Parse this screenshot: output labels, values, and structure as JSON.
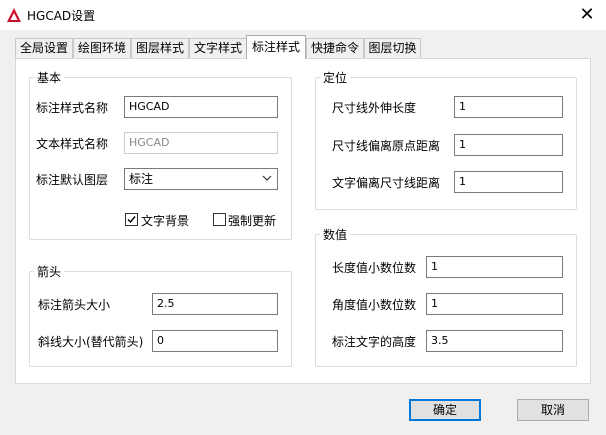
{
  "window": {
    "title": "HGCAD设置",
    "close_glyph": "✕"
  },
  "tabs": [
    {
      "label": "全局设置"
    },
    {
      "label": "绘图环境"
    },
    {
      "label": "图层样式"
    },
    {
      "label": "文字样式"
    },
    {
      "label": "标注样式",
      "active": true
    },
    {
      "label": "快捷命令"
    },
    {
      "label": "图层切换"
    }
  ],
  "basic": {
    "legend": "基本",
    "dim_style_name_label": "标注样式名称",
    "dim_style_name_value": "HGCAD",
    "text_style_name_label": "文本样式名称",
    "text_style_name_value": "HGCAD",
    "default_layer_label": "标注默认图层",
    "default_layer_value": "标注",
    "text_bg_label": "文字背景",
    "text_bg_checked": true,
    "force_update_label": "强制更新",
    "force_update_checked": false
  },
  "arrow": {
    "legend": "箭头",
    "arrow_size_label": "标注箭头大小",
    "arrow_size_value": "2.5",
    "oblique_size_label": "斜线大小(替代箭头)",
    "oblique_size_value": "0"
  },
  "position": {
    "legend": "定位",
    "ext_len_label": "尺寸线外伸长度",
    "ext_len_value": "1",
    "origin_offset_label": "尺寸线偏离原点距离",
    "origin_offset_value": "1",
    "text_offset_label": "文字偏离尺寸线距离",
    "text_offset_value": "1"
  },
  "numeric": {
    "legend": "数值",
    "length_decimals_label": "长度值小数位数",
    "length_decimals_value": "1",
    "angle_decimals_label": "角度值小数位数",
    "angle_decimals_value": "1",
    "text_height_label": "标注文字的高度",
    "text_height_value": "3.5"
  },
  "buttons": {
    "ok": "确定",
    "cancel": "取消"
  },
  "colors": {
    "accent": "#0078d7",
    "app_icon": "#c8102e"
  },
  "icons": {
    "app": "hgcad-logo-icon",
    "close": "close-icon",
    "dropdown": "chevron-down-icon",
    "check": "checkmark-icon"
  }
}
